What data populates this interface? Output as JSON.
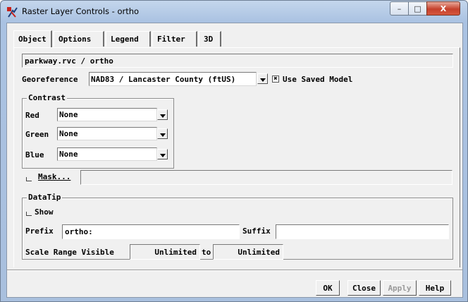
{
  "window": {
    "title": "Raster Layer Controls - ortho",
    "minimize": "–",
    "maximize": "□",
    "close": "X"
  },
  "tabs": [
    "Object",
    "Options",
    "Legend",
    "Filter",
    "3D"
  ],
  "object": {
    "path": "parkway.rvc / ortho"
  },
  "georeference": {
    "label": "Georeference",
    "value": "NAD83 / Lancaster County (ftUS)",
    "use_saved_model_label": "Use Saved Model",
    "use_saved_model_checked": true,
    "checkbox_mark": "✖"
  },
  "contrast": {
    "title": "Contrast",
    "red": {
      "label": "Red",
      "value": "None"
    },
    "green": {
      "label": "Green",
      "value": "None"
    },
    "blue": {
      "label": "Blue",
      "value": "None"
    }
  },
  "mask": {
    "label": "Mask...",
    "value": ""
  },
  "datatip": {
    "title": "DataTip",
    "show_label": "Show",
    "prefix_label": "Prefix",
    "prefix_value": "ortho:",
    "suffix_label": "Suffix",
    "suffix_value": "",
    "scale_range_label": "Scale Range Visible",
    "min_value": "Unlimited",
    "to_label": "to",
    "max_value": "Unlimited"
  },
  "buttons": {
    "ok": "OK",
    "close": "Close",
    "apply": "Apply",
    "help": "Help"
  }
}
